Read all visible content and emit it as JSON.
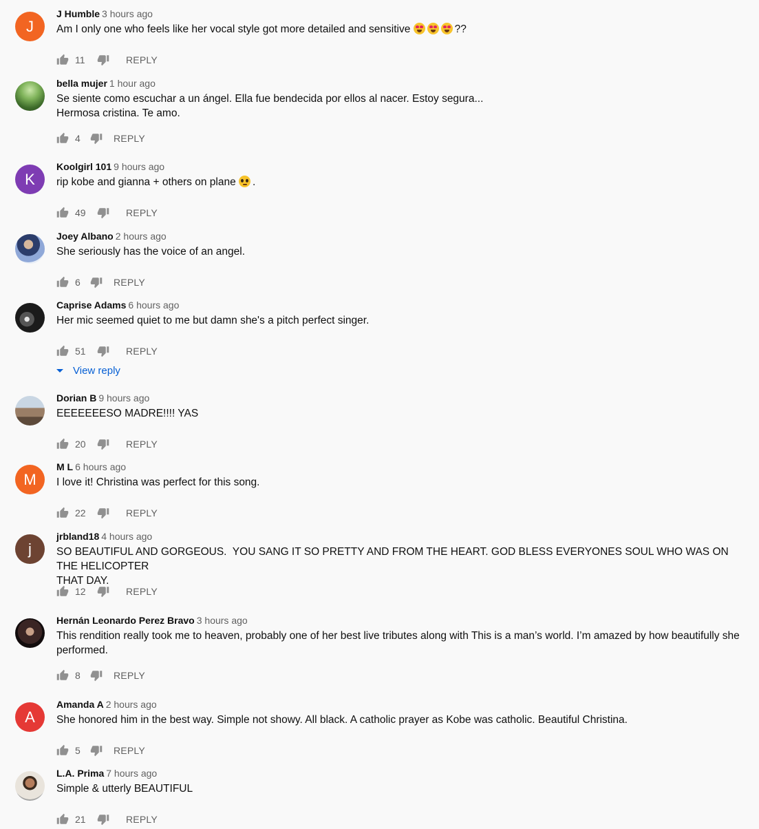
{
  "reply_label": "REPLY",
  "view_reply_label": "View reply",
  "colors": {
    "text": "#0f0f0f",
    "muted": "#606060",
    "link": "#065fd4",
    "background": "#f9f9f9"
  },
  "comments": [
    {
      "author": "J Humble",
      "time": "3 hours ago",
      "text_before": "Am I only one who feels like her vocal style got more detailed and sensitive ",
      "text_after": "??",
      "emoji_count": 3,
      "emoji": "heart-eyes-face",
      "likes": "11",
      "avatar": {
        "type": "letter",
        "letter": "J",
        "color": "#f26522"
      }
    },
    {
      "author": "bella mujer",
      "time": "1 hour ago",
      "text": "Se siente como escuchar a un ángel. Ella fue bendecida por ellos al nacer. Estoy segura...\nHermosa cristina. Te amo.",
      "likes": "4",
      "avatar": {
        "type": "image",
        "scene": "forest-photo"
      }
    },
    {
      "author": "Koolgirl 101",
      "time": "9 hours ago",
      "text_before": "rip kobe and gianna + others on plane ",
      "text_after": ".",
      "emoji_count": 1,
      "emoji": "pleading-face",
      "likes": "49",
      "avatar": {
        "type": "letter",
        "letter": "K",
        "color": "#7e3cb3"
      }
    },
    {
      "author": "Joey Albano",
      "time": "2 hours ago",
      "text": "She seriously has the voice of an angel.",
      "likes": "6",
      "avatar": {
        "type": "image",
        "scene": "person-photo"
      }
    },
    {
      "author": "Caprise Adams",
      "time": "6 hours ago",
      "text": "Her mic seemed quiet to me but damn she's a pitch perfect singer.",
      "likes": "51",
      "avatar": {
        "type": "image",
        "scene": "dark-photo"
      }
    },
    {
      "author": "Dorian B",
      "time": "9 hours ago",
      "text": "EEEEEEESO MADRE!!!! YAS",
      "likes": "20",
      "avatar": {
        "type": "image",
        "scene": "landscape-photo"
      }
    },
    {
      "author": "M L",
      "time": "6 hours ago",
      "text": "I love it! Christina was perfect for this song.",
      "likes": "22",
      "avatar": {
        "type": "letter",
        "letter": "M",
        "color": "#f26522"
      }
    },
    {
      "author": "jrbland18",
      "time": "4 hours ago",
      "text": "SO BEAUTIFUL AND GORGEOUS.  YOU SANG IT SO PRETTY AND FROM THE HEART. GOD BLESS EVERYONES SOUL WHO WAS ON THE HELICOPTER\nTHAT DAY.",
      "likes": "12",
      "avatar": {
        "type": "letter",
        "letter": "j",
        "color": "#6d4332"
      }
    },
    {
      "author": "Hernán Leonardo Perez Bravo",
      "time": "3 hours ago",
      "text": "This rendition really took me to heaven, probably one of her best live tributes along with This is a man’s world. I’m amazed by how beautifully she\nperformed.",
      "likes": "8",
      "avatar": {
        "type": "image",
        "scene": "portrait-photo"
      }
    },
    {
      "author": "Amanda A",
      "time": "2 hours ago",
      "text": "She honored him in the best way. Simple not showy. All black. A catholic prayer as Kobe was catholic. Beautiful Christina.",
      "likes": "5",
      "avatar": {
        "type": "letter",
        "letter": "A",
        "color": "#e53935"
      }
    },
    {
      "author": "L.A. Prima",
      "time": "7 hours ago",
      "text": "Simple & utterly BEAUTIFUL",
      "likes": "21",
      "avatar": {
        "type": "image",
        "scene": "selfie-photo"
      }
    }
  ]
}
